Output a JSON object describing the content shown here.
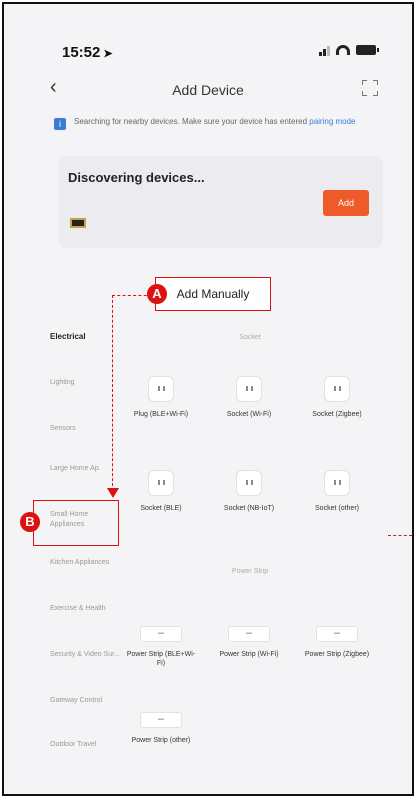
{
  "status_bar": {
    "time": "15:52"
  },
  "nav": {
    "title": "Add Device"
  },
  "notice": {
    "text": "Searching for nearby devices. Make sure your device has entered ",
    "link": "pairing mode"
  },
  "discover": {
    "title": "Discovering devices...",
    "add_label": "Add"
  },
  "add_manually": {
    "label": "Add Manually"
  },
  "annotations": {
    "a": "A",
    "b": "B"
  },
  "categories": [
    "Electrical",
    "Lighting",
    "Sensors",
    "Large Home Ap.",
    "Small Home Appliances",
    "Kitchen Appliances",
    "Exercise & Health",
    "Security & Video Sur...",
    "Gateway Control",
    "Outdoor Travel"
  ],
  "sections": [
    {
      "title": "Socket",
      "items": [
        "Plug (BLE+Wi-Fi)",
        "Socket (Wi-Fi)",
        "Socket (Zigbee)",
        "Socket (BLE)",
        "Socket (NB-IoT)",
        "Socket (other)"
      ]
    },
    {
      "title": "Power Strip",
      "items": [
        "Power Strip (BLE+Wi-Fi)",
        "Power Strip (Wi-Fi)",
        "Power Strip (Zigbee)",
        "Power Strip (other)"
      ]
    }
  ]
}
